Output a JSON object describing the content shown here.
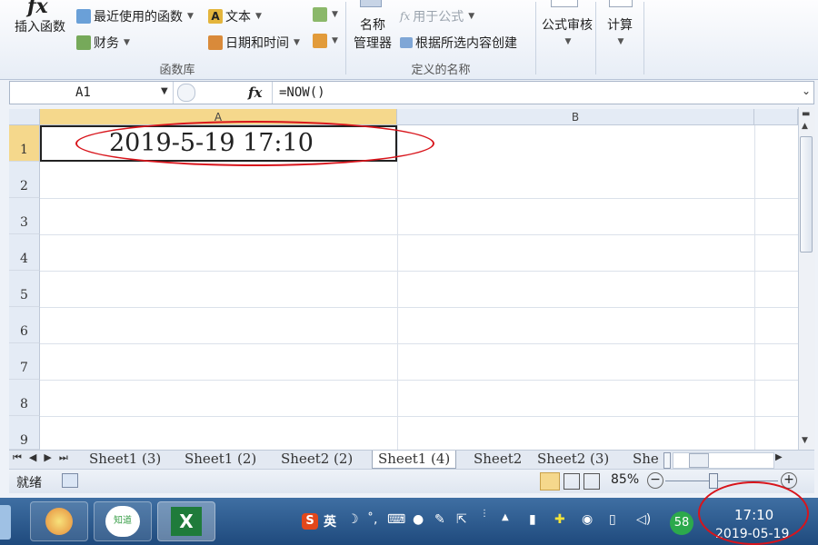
{
  "ribbon": {
    "insert_function": "插入函数",
    "recently_used": "最近使用的函数",
    "text": "文本",
    "finance": "财务",
    "datetime": "日期和时间",
    "function_library": "函数库",
    "name_manager_line1": "名称",
    "name_manager_line2": "管理器",
    "use_in_formula": "用于公式",
    "create_from_selection": "根据所选内容创建",
    "defined_names": "定义的名称",
    "formula_auditing": "公式审核",
    "calculation": "计算"
  },
  "formula_bar": {
    "name_box": "A1",
    "fx": "fx",
    "formula": "=NOW()"
  },
  "grid": {
    "columns": [
      "A",
      "B"
    ],
    "rows": [
      "1",
      "2",
      "3",
      "4",
      "5",
      "6",
      "7",
      "8",
      "9"
    ],
    "cell_a1": "2019-5-19  17:10"
  },
  "sheet_tabs": [
    "Sheet1 (3)",
    "Sheet1 (2)",
    "Sheet2 (2)",
    "Sheet1 (4)",
    "Sheet2",
    "Sheet2 (3)",
    "She"
  ],
  "status": {
    "ready": "就绪",
    "zoom": "85%"
  },
  "taskbar": {
    "zhidao_label": "知道",
    "ime_label": "英",
    "badge_count": "58",
    "time": "17:10",
    "date": "2019-05-19"
  },
  "colors": {
    "annotation": "#d8141b",
    "taskbar": "#2b5a8e",
    "ribbon_bg": "#eef2f8"
  }
}
